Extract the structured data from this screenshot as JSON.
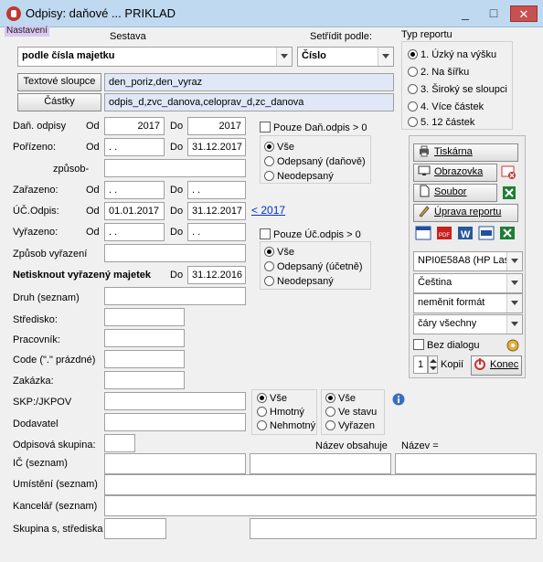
{
  "window": {
    "title": "Odpisy: daňové     ... PRIKLAD",
    "minimize": "_",
    "maximize": "□",
    "close": "✕"
  },
  "menu": {
    "nastaveni": "Nastavení"
  },
  "sestava": {
    "label": "Sestava",
    "value": "podle čísla majetku"
  },
  "setridit": {
    "label": "Setřídit podle:",
    "value": "Číslo"
  },
  "typ_reportu": {
    "label": "Typ reportu",
    "options": [
      "1. Úzký na výšku",
      "2. Na šířku",
      "3. Široký se sloupci",
      "4. Více částek",
      "5. 12 částek"
    ],
    "selected": 0
  },
  "textove_sloupce": {
    "button": "Textové sloupce",
    "value": "den_poriz,den_vyraz"
  },
  "castky": {
    "button": "Částky",
    "value": "odpis_d,zvc_danova,celoprav_d,zc_danova"
  },
  "dan_odpisy": {
    "label": "Daň. odpisy",
    "od": "Od",
    "do": "Do",
    "od_value": "2017",
    "do_value": "2017"
  },
  "porizeno": {
    "label": "Pořízeno:",
    "od": "Od",
    "do": "Do",
    "od_value": " .  .",
    "do_value": "31.12.2017"
  },
  "zpusob": {
    "label": "způsob-",
    "value": ""
  },
  "zarazeno": {
    "label": "Zařazeno:",
    "od": "Od",
    "do": "Do",
    "od_value": " .  .",
    "do_value": " .  ."
  },
  "uc_odpis": {
    "label": "ÚČ.Odpis:",
    "od": "Od",
    "do": "Do",
    "od_value": "01.01.2017",
    "do_value": "31.12.2017",
    "link": "< 2017"
  },
  "vyrazeno": {
    "label": "Vyřazeno:",
    "od": "Od",
    "do": "Do",
    "od_value": " .  .",
    "do_value": " .  ."
  },
  "zpusob_vyrazeni": {
    "label": "Způsob vyřazení",
    "value": ""
  },
  "netisknout": {
    "label": "Netisknout vyřazený majetek",
    "do": "Do",
    "value": "31.12.2016"
  },
  "pouze_dan": {
    "label": "Pouze Daň.odpis > 0",
    "options": [
      "Vše",
      "Odepsaný (daňově)",
      "Neodepsaný"
    ],
    "selected": 0
  },
  "pouze_uc": {
    "label": "Pouze Úč.odpis > 0",
    "options": [
      "Vše",
      "Odepsaný (účetně)",
      "Neodepsaný"
    ],
    "selected": 0
  },
  "druh": {
    "label": "Druh (seznam)",
    "value": ""
  },
  "stredisko": {
    "label": "Středisko:",
    "value": ""
  },
  "pracovnik": {
    "label": "Pracovník:",
    "value": ""
  },
  "code": {
    "label": "Code (\".\" prázdné)",
    "value": ""
  },
  "zakazka": {
    "label": "Zakázka:",
    "value": ""
  },
  "skp": {
    "label": "SKP:/JKPOV",
    "value": ""
  },
  "dodavatel": {
    "label": "Dodavatel",
    "value": ""
  },
  "hmotny": {
    "options": [
      "Vše",
      "Hmotný",
      "Nehmotný"
    ],
    "selected": 0
  },
  "stav": {
    "options": [
      "Vše",
      "Ve stavu",
      "Vyřazen"
    ],
    "selected": 0
  },
  "odpisova_skupina": {
    "label": "Odpisová skupina:",
    "value": ""
  },
  "nazev_obsahuje": {
    "label": "Název obsahuje",
    "value": ""
  },
  "nazev_eq": {
    "label": "Název =",
    "value": ""
  },
  "ic": {
    "label": "IČ      (seznam)",
    "value": ""
  },
  "umisteni": {
    "label": "Umístění (seznam)",
    "value": ""
  },
  "kancelar": {
    "label": "Kancelář (seznam)",
    "value": ""
  },
  "skupina": {
    "label": "Skupina s, střediska",
    "value": ""
  },
  "output": {
    "tiskarna": "Tiskárna",
    "obrazovka": "Obrazovka",
    "soubor": "Soubor",
    "uprava": "Úprava reportu",
    "printer": "NPI0E58A8 (HP Las",
    "language": "Čeština",
    "format": "neměnit formát",
    "cary": "čáry všechny",
    "bez_dialogu": "Bez dialogu",
    "kopii_value": "1",
    "kopii_label": "Kopií",
    "konec": "Konec"
  },
  "colors": {
    "accent": "#0033cc",
    "close": "#c75050",
    "title_bg": "#bfd9f0",
    "blue_field": "#e0e8f8"
  }
}
